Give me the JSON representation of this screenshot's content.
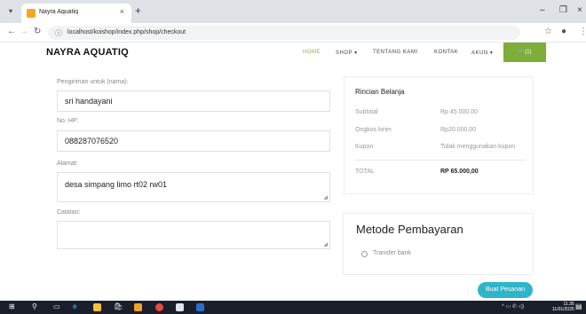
{
  "browser": {
    "tab_title": "Nayra Aquatiq",
    "tab_close": "×",
    "new_tab": "+",
    "url": "localhost/koishop/index.php/shop/checkout",
    "win_minimize": "–",
    "win_restore": "❐",
    "win_close": "×"
  },
  "site": {
    "brand": "NAYRA AQUATIQ",
    "nav": {
      "home": "HOME",
      "shop": "SHOP ▾",
      "about": "TENTANG KAMI",
      "contact": "KONTAK",
      "account": "AKUN ▾",
      "cart": "🛒(1)"
    }
  },
  "form": {
    "recipient_label": "Pengiriman untuk (nama):",
    "recipient_value": "sri handayani",
    "phone_label": "No. HP:",
    "phone_value": "088287076520",
    "address_label": "Alamat:",
    "address_value": "desa simpang limo rt02 rw01",
    "notes_label": "Catatan:",
    "notes_value": ""
  },
  "summary": {
    "title": "Rincian Belanja",
    "subtotal_label": "Subtotal",
    "subtotal_value": "Rp 45.000,00",
    "shipping_label": "Ongkos kirim",
    "shipping_value": "Rp20.000,00",
    "coupon_label": "Kupon",
    "coupon_value": "Tidak menggunakan kupon",
    "total_label": "TOTAL",
    "total_value": "RP 65.000,00"
  },
  "payment": {
    "title": "Metode Pembayaran",
    "option_bank": "Transfer bank"
  },
  "actions": {
    "submit_label": "Buat Pesanan"
  },
  "taskbar": {
    "time": "11.35",
    "date": "11/01/2025"
  },
  "colors": {
    "accent_green": "#7fad39",
    "submit_teal": "#2eb5c9"
  }
}
